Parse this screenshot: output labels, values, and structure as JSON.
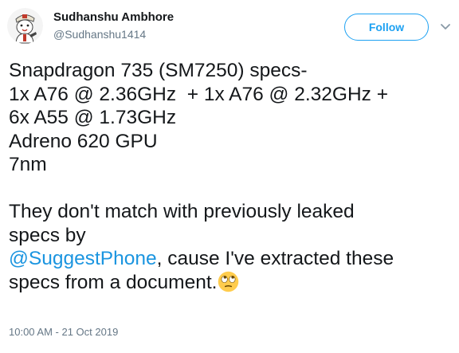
{
  "author": {
    "name": "Sudhanshu Ambhore",
    "handle": "@Sudhanshu1414"
  },
  "follow_button": {
    "label": "Follow"
  },
  "tweet": {
    "lines": [
      "Snapdragon 735 (SM7250) specs-",
      "1x A76 @ 2.36GHz  + 1x A76 @ 2.32GHz +",
      "6x A55 @ 1.73GHz",
      "Adreno 620 GPU",
      "7nm"
    ],
    "para2_line1": "They don't match with previously leaked",
    "para2_line2": "specs by",
    "mention": "@SuggestPhone",
    "para2_after_mention": ", cause I've extracted these",
    "para2_last": "specs from a document.",
    "emoji": "face-with-rolling-eyes"
  },
  "timestamp": "10:00 AM - 21 Oct 2019",
  "colors": {
    "accent": "#1da1f2",
    "link": "#1b95e0",
    "text": "#14171a",
    "secondary": "#657786"
  },
  "icons": {
    "avatar": "cartoon-avatar",
    "menu": "chevron-down-icon"
  }
}
